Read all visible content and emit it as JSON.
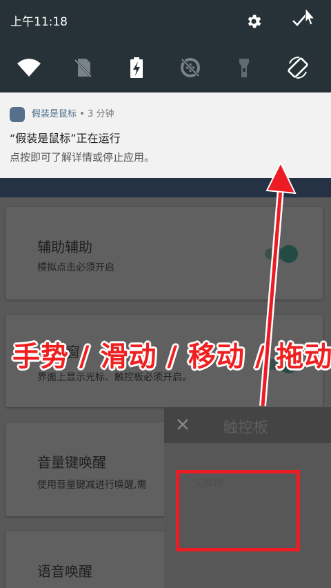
{
  "status_bar": {
    "time": "上午11:18",
    "icons": [
      "gear-icon",
      "collapse-shade-icon"
    ]
  },
  "quick_settings": {
    "tiles": [
      "wifi-icon",
      "no-sim-icon",
      "battery-charging-icon",
      "data-saver-off-icon",
      "flashlight-icon",
      "auto-rotate-icon"
    ]
  },
  "notification": {
    "app_name": "假装是鼠标",
    "separator": " • ",
    "age": "3 分钟",
    "title": "“假装是鼠标”正在运行",
    "text": "点按即可了解详情或停止应用。"
  },
  "cards": [
    {
      "title": "辅助辅助",
      "subtitle": "模拟点击必须开启"
    },
    {
      "title": "窗",
      "subtitle": "界面上显示光标、触控板必须开启。"
    },
    {
      "title": "音量键唤醒",
      "subtitle": "使用音量键减进行唤醒,需"
    },
    {
      "title": "语音唤醒",
      "subtitle": ""
    }
  ],
  "touchpad": {
    "title": "触控板",
    "hint": "无障碍"
  },
  "overlay": {
    "caption": "手势 / 滑动 / 移动 / 拖动",
    "accent_color": "#ec1c24"
  }
}
